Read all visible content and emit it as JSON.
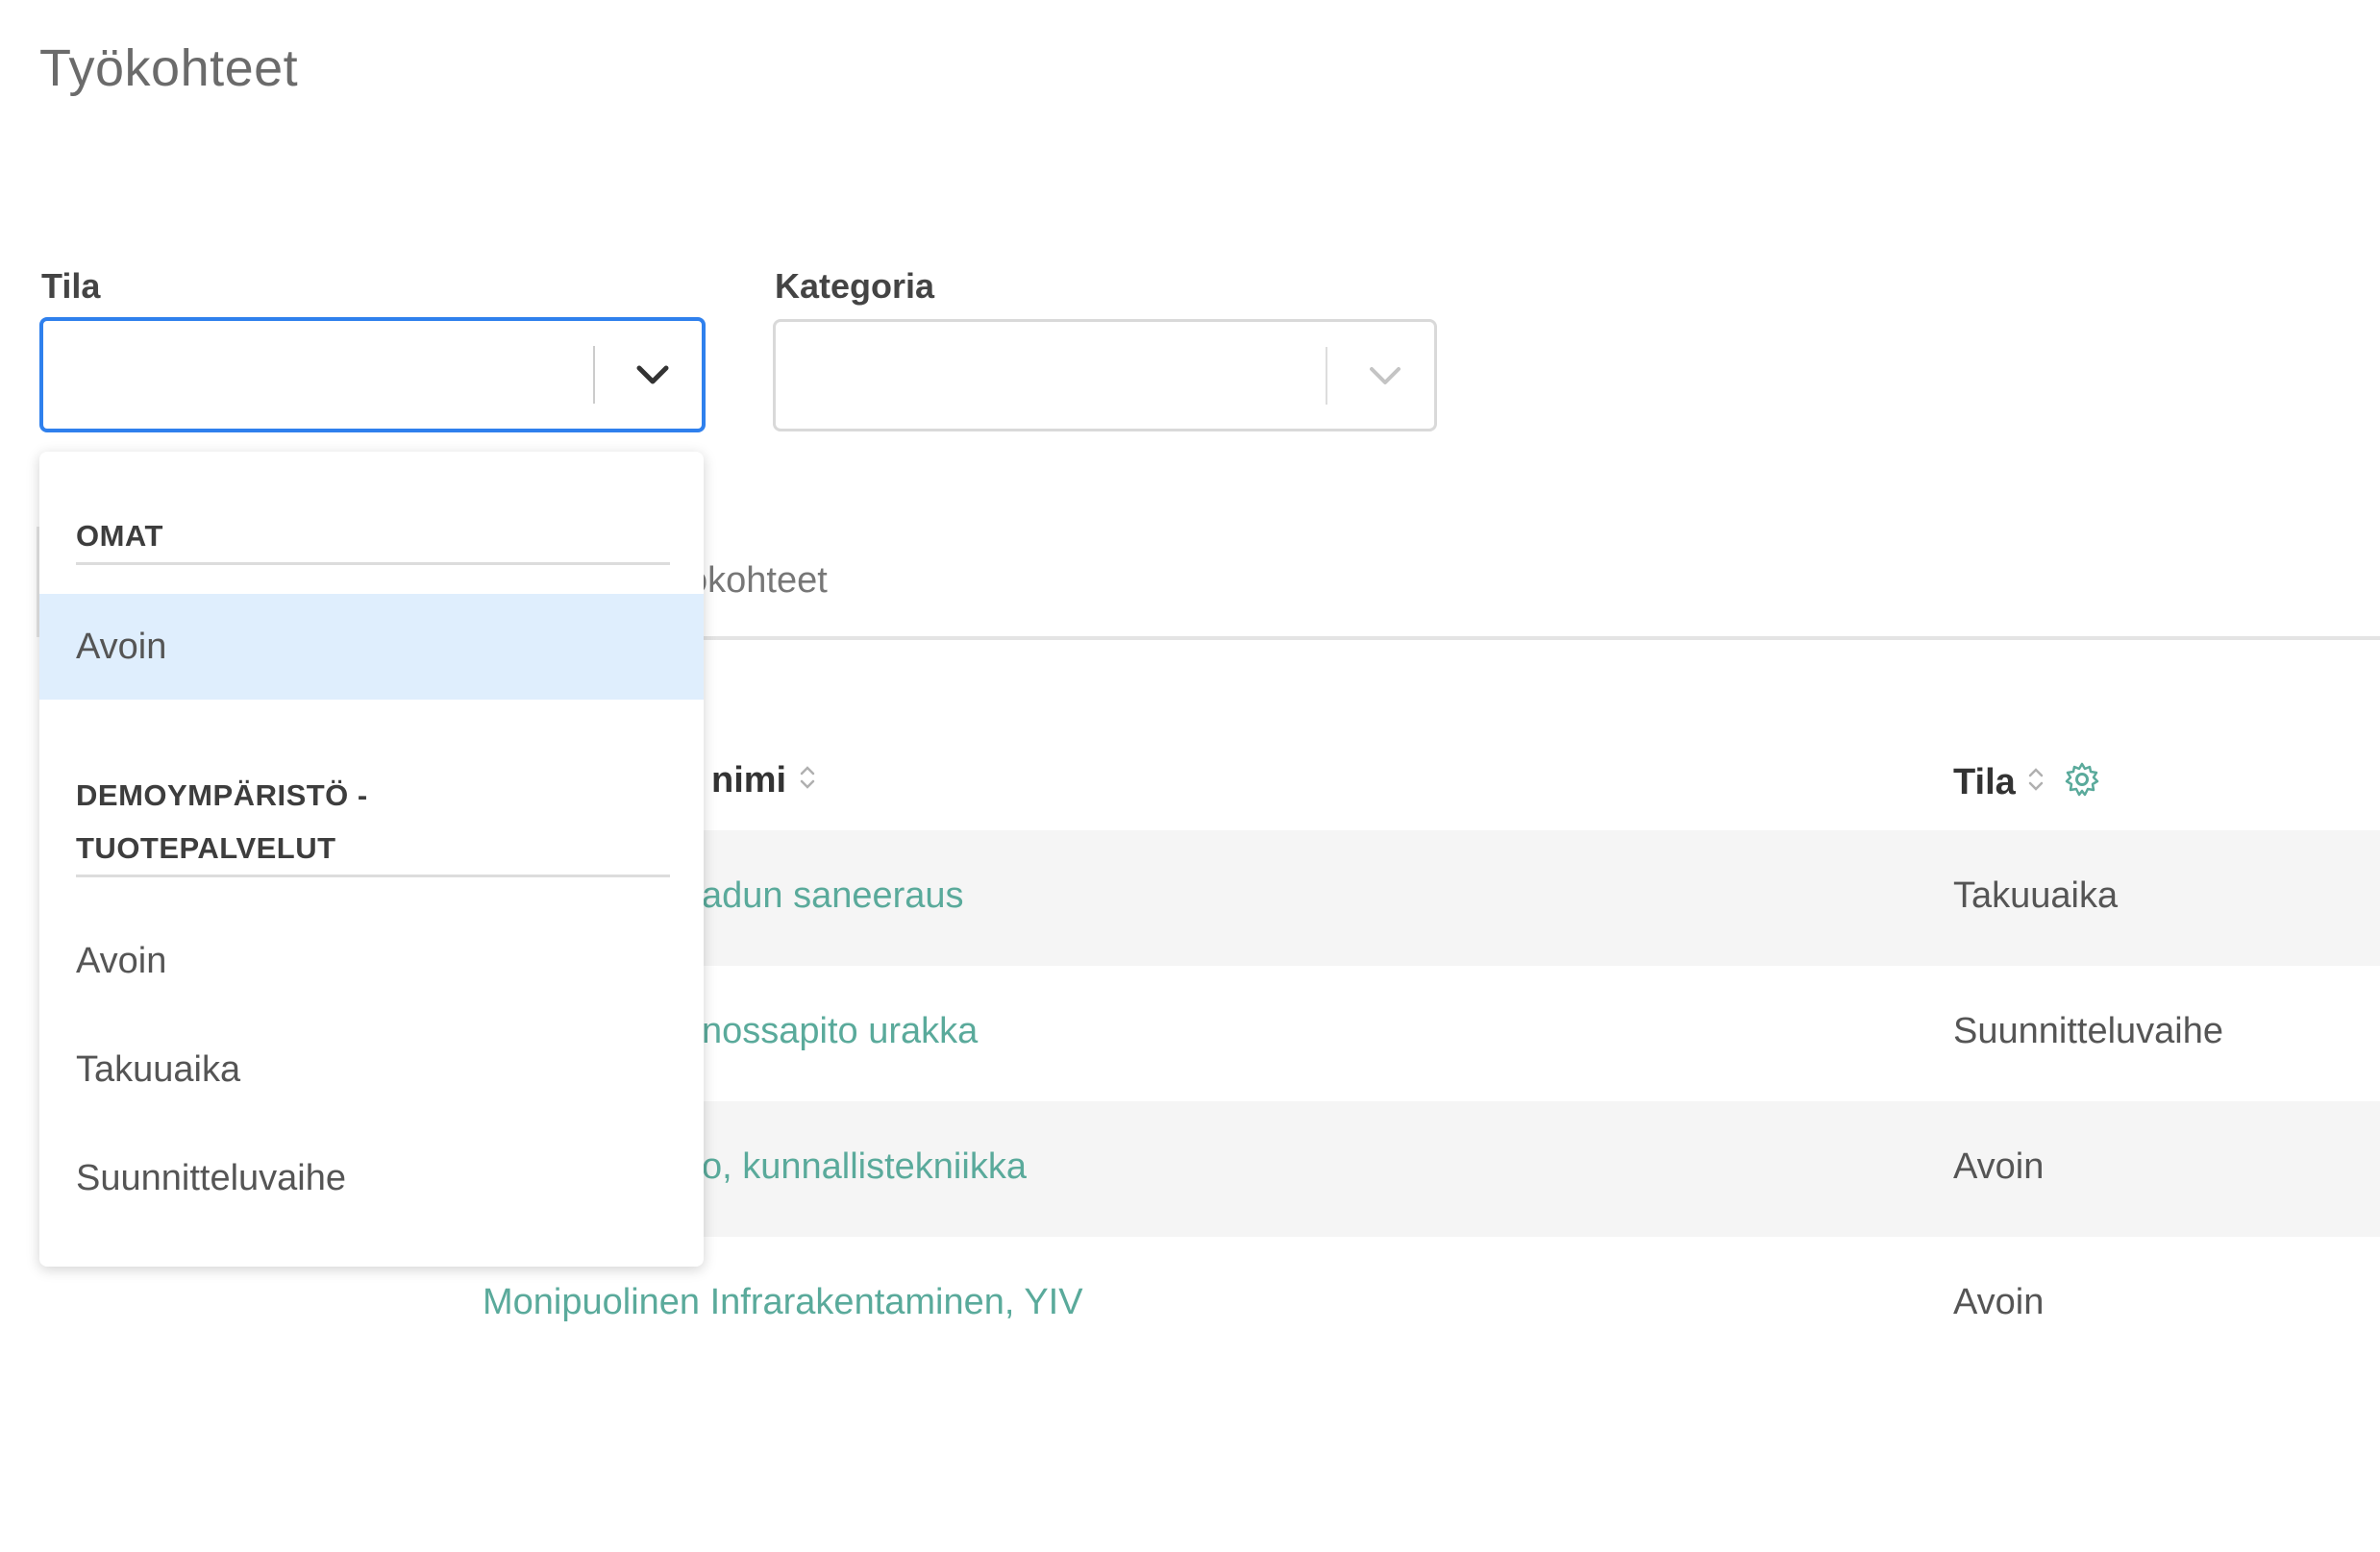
{
  "page": {
    "title": "Työkohteet"
  },
  "filters": {
    "status": {
      "label": "Tila",
      "value": "",
      "dropdown_open": true
    },
    "category": {
      "label": "Kategoria",
      "value": ""
    }
  },
  "tabs": {
    "visible_label": "ökohteet"
  },
  "table": {
    "columns": [
      {
        "label": "nimi",
        "sortable": true
      },
      {
        "label": "Tila",
        "sortable": true,
        "has_settings": true
      }
    ],
    "rows": [
      {
        "name": "adun saneeraus",
        "status": "Takuuaika"
      },
      {
        "name": "nossapito urakka",
        "status": "Suunnitteluvaihe"
      },
      {
        "name": "o, kunnallistekniikka",
        "status": "Avoin"
      },
      {
        "name": "Monipuolinen Infrarakentaminen, YIV",
        "status": "Avoin"
      }
    ]
  },
  "dropdown": {
    "groups": [
      {
        "header": "OMAT",
        "options": [
          {
            "label": "Avoin",
            "highlighted": true
          }
        ]
      },
      {
        "header_lines": [
          "DEMOYMPÄRISTÖ -",
          "TUOTEPALVELUT"
        ],
        "options": [
          {
            "label": "Avoin"
          },
          {
            "label": "Takuuaika"
          },
          {
            "label": "Suunnitteluvaihe"
          }
        ]
      }
    ]
  },
  "colors": {
    "focus_border": "#2f80ed",
    "link": "#5aaa9b",
    "option_highlight": "#dfeefd",
    "row_stripe": "#f5f5f5"
  },
  "icons": {
    "select_chevron": "chevron-down-icon",
    "sort": "sort-icon",
    "column_settings": "gear-icon"
  }
}
